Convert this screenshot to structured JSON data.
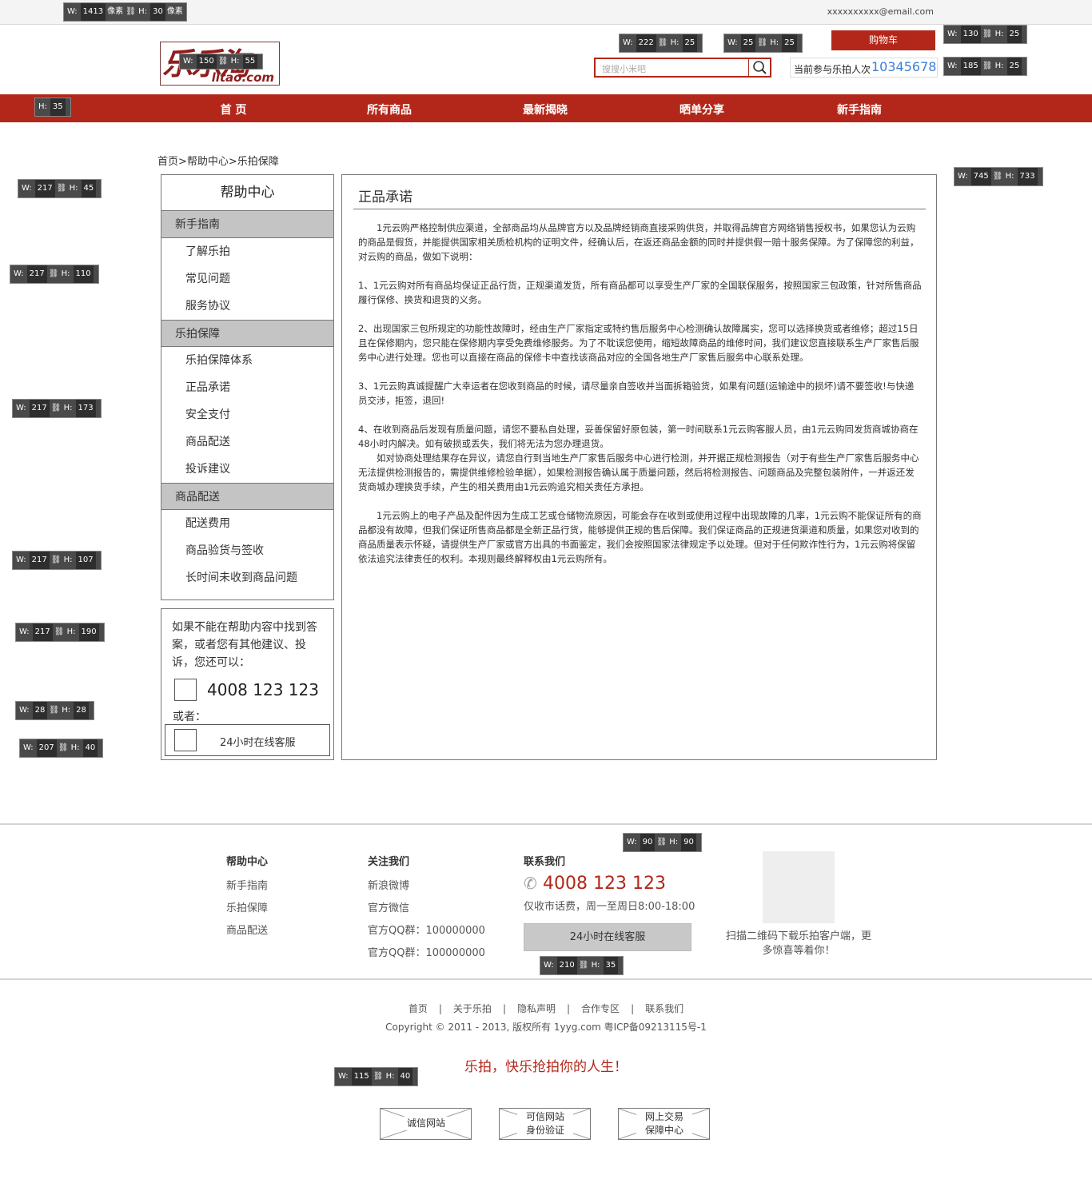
{
  "header": {
    "email": "xxxxxxxxxx@email.com",
    "logo_cn": "乐乐淘",
    "logo_en": "lltao.com",
    "cart_label": "购物车",
    "search_placeholder": "搜搜小米吧",
    "count_label": "当前参与乐拍人次",
    "count_value": "10345678"
  },
  "nav": [
    "首 页",
    "所有商品",
    "最新揭晓",
    "晒单分享",
    "新手指南"
  ],
  "breadcrumb": "首页>帮助中心>乐拍保障",
  "sidebar": {
    "title": "帮助中心",
    "groups": [
      {
        "label": "新手指南",
        "items": [
          "了解乐拍",
          "常见问题",
          "服务协议"
        ]
      },
      {
        "label": "乐拍保障",
        "items": [
          "乐拍保障体系",
          "正品承诺",
          "安全支付",
          "商品配送",
          "投诉建议"
        ]
      },
      {
        "label": "商品配送",
        "items": [
          "配送费用",
          "商品验货与签收",
          "长时间未收到商品问题"
        ]
      }
    ]
  },
  "help_box": {
    "text": "如果不能在帮助内容中找到答案，或者您有其他建议、投诉，您还可以：",
    "phone": "4008 123 123",
    "or": "或者：",
    "service": "24小时在线客服"
  },
  "article": {
    "title": "正品承诺",
    "p1": "1元云购严格控制供应渠道，全部商品均从品牌官方以及品牌经销商直接采购供货，并取得品牌官方网络销售授权书，如果您认为云购的商品是假货，并能提供国家相关质检机构的证明文件，经确认后，在返还商品金额的同时并提供假一赔十服务保障。为了保障您的利益，对云购的商品，做如下说明：",
    "p2": "1、1元云购对所有商品均保证正品行货，正规渠道发货，所有商品都可以享受生产厂家的全国联保服务，按照国家三包政策，针对所售商品履行保修、换货和退货的义务。",
    "p3": "2、出现国家三包所规定的功能性故障时，经由生产厂家指定或特约售后服务中心检测确认故障属实，您可以选择换货或者维修；超过15日且在保修期内，您只能在保修期内享受免费维修服务。为了不耽误您使用，缩短故障商品的维修时间，我们建议您直接联系生产厂家售后服务中心进行处理。您也可以直接在商品的保修卡中查找该商品对应的全国各地生产厂家售后服务中心联系处理。",
    "p4": "3、1元云购真诚提醒广大幸运者在您收到商品的时候，请尽量亲自签收并当面拆箱验货，如果有问题(运输途中的损坏)请不要签收!与快递员交涉，拒签，退回!",
    "p5a": "4、在收到商品后发现有质量问题，请您不要私自处理，妥善保留好原包装，第一时间联系1元云购客服人员，由1元云购同发货商城协商在48小时内解决。如有破损或丢失，我们将无法为您办理退货。",
    "p5b": "如对协商处理结果存在异议，请您自行到当地生产厂家售后服务中心进行检测，并开据正规检测报告（对于有些生产厂家售后服务中心无法提供检测报告的，需提供维修检验单据），如果检测报告确认属于质量问题，然后将检测报告、问题商品及完整包装附件，一并返还发货商城办理换货手续，产生的相关费用由1元云购追究相关责任方承担。",
    "p6": "1元云购上的电子产品及配件因为生成工艺或仓储物流原因，可能会存在收到或使用过程中出现故障的几率，1元云购不能保证所有的商品都没有故障，但我们保证所售商品都是全新正品行货，能够提供正规的售后保障。我们保证商品的正规进货渠道和质量，如果您对收到的商品质量表示怀疑，请提供生产厂家或官方出具的书面鉴定，我们会按照国家法律规定予以处理。但对于任何欺诈性行为，1元云购将保留依法追究法律责任的权利。本规则最终解释权由1元云购所有。"
  },
  "footer": {
    "col1": {
      "title": "帮助中心",
      "items": [
        "新手指南",
        "乐拍保障",
        "商品配送"
      ]
    },
    "col2": {
      "title": "关注我们",
      "items": [
        "新浪微博",
        "官方微信",
        "官方QQ群：100000000",
        "官方QQ群：100000000"
      ]
    },
    "col3": {
      "title": "联系我们",
      "phone": "4008 123 123",
      "hours": "仅收市话费，周一至周日8:00-18:00",
      "service": "24小时在线客服"
    },
    "qr_text": "扫描二维码下载乐拍客户端，更多惊喜等着你！",
    "links": [
      "首页",
      "关于乐拍",
      "隐私声明",
      "合作专区",
      "联系我们"
    ],
    "copyright": "Copyright © 2011 - 2013, 版权所有 1yyg.com 粤ICP备09213115号-1",
    "slogan": "乐拍，快乐抢拍你的人生！",
    "badges": [
      "诚信网站",
      "可信网站\n身份验证",
      "网上交易\n保障中心"
    ]
  },
  "annotations": {
    "a_top": {
      "w": "1413",
      "h": "30"
    },
    "a_logo": {
      "w": "150",
      "h": "55"
    },
    "a_search": {
      "w": "222",
      "h": "25"
    },
    "a_searchbtn": {
      "w": "25",
      "h": "25"
    },
    "a_cart": {
      "w": "130",
      "h": "25"
    },
    "a_count": {
      "w": "185",
      "h": "25"
    },
    "a_nav": {
      "h": "35"
    },
    "a_title": {
      "w": "217",
      "h": "45"
    },
    "a_g1": {
      "w": "217",
      "h": "110"
    },
    "a_g2": {
      "w": "217",
      "h": "173"
    },
    "a_g3": {
      "w": "217",
      "h": "107"
    },
    "a_help": {
      "w": "217",
      "h": "190"
    },
    "a_sq": {
      "w": "28",
      "h": "28"
    },
    "a_svc": {
      "w": "207",
      "h": "40"
    },
    "a_main": {
      "w": "745",
      "h": "733"
    },
    "a_qr": {
      "w": "90",
      "h": "90"
    },
    "a_fsvc": {
      "w": "210",
      "h": "35"
    },
    "a_badge": {
      "w": "115",
      "h": "40"
    },
    "unit": "像素"
  }
}
